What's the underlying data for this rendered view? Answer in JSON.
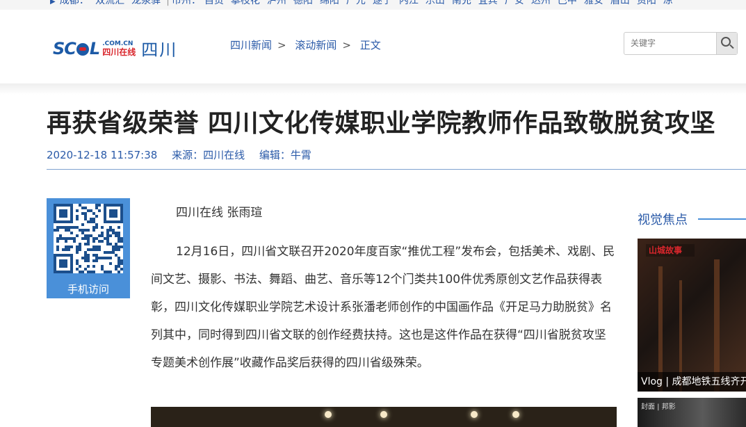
{
  "topnav": {
    "region": "成都：",
    "cities_a": [
      "双流汇",
      "龙泉驿"
    ],
    "prefix": "市州：",
    "cities_b": [
      "自贡",
      "攀枝花",
      "泸州",
      "德阳",
      "绵阳",
      "广元",
      "遂宁",
      "内江",
      "乐山",
      "南充",
      "宜宾",
      "广安",
      "达州",
      "巴中",
      "雅安",
      "眉山",
      "资阳",
      "凉"
    ]
  },
  "logo": {
    "main_s": "SC",
    "main_l": "L",
    "domain": ".COM.CN",
    "cn": "四川在线",
    "province": "四川"
  },
  "breadcrumb": [
    "四川新闻",
    "滚动新闻",
    "正文"
  ],
  "search": {
    "placeholder": "关键字"
  },
  "article": {
    "title": "再获省级荣誉 四川文化传媒职业学院教师作品致敬脱贫攻坚",
    "datetime": "2020-12-18 11:57:38",
    "source": "来源：四川在线",
    "editor": "编辑：牛霄",
    "byline": "四川在线 张雨瑄",
    "paragraph": "12月16日，四川省文联召开2020年度百家“推优工程”发布会，包括美术、戏剧、民间文艺、摄影、书法、舞蹈、曲艺、音乐等12个门类共100件优秀原创文艺作品获得表彰，四川文化传媒职业学院艺术设计系张潘老师创作的中国画作品《开足马力助脱贫》名列其中，同时得到四川省文联的创作经费扶持。这也是这件作品在获得“四川省脱贫攻坚专题美术创作展”收藏作品奖后获得的四川省级殊荣。"
  },
  "qr": {
    "label": "手机访问"
  },
  "sidebar": {
    "title": "视觉焦点",
    "item1_badge": "山城故事",
    "item1_caption": "Vlog | 成都地铁五线齐开",
    "item2_tag": "封面 | 邦影"
  },
  "colors": {
    "brand_blue": "#2a5aa8",
    "logo_red": "#d9262c",
    "qr_blue": "#4a90d9"
  }
}
